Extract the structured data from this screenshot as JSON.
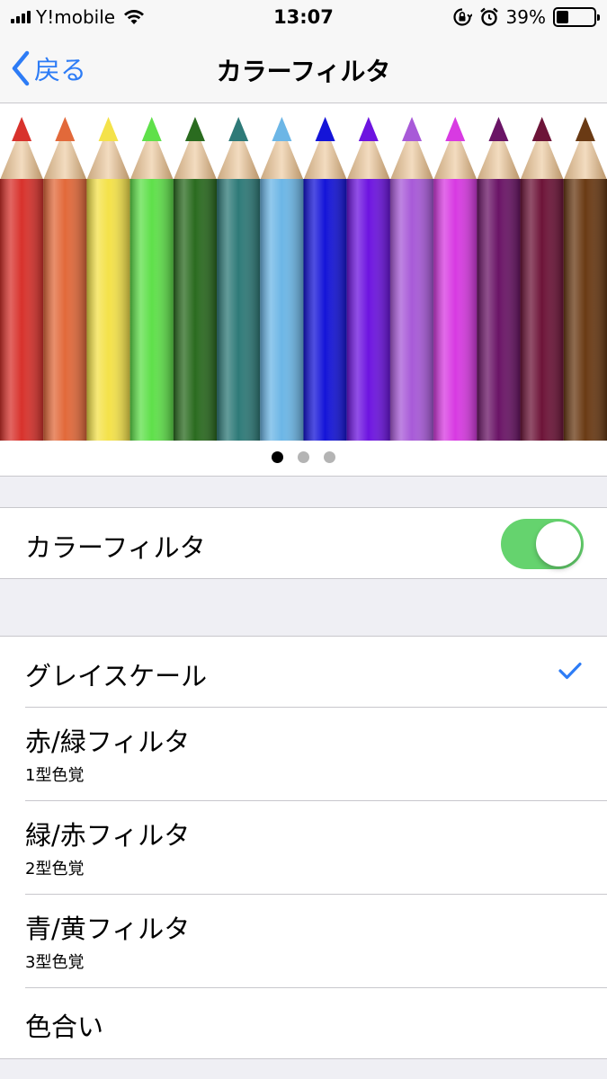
{
  "status_bar": {
    "carrier": "Y!mobile",
    "time": "13:07",
    "battery_percent": "39%",
    "battery_level": 0.39,
    "icons": [
      "signal-icon",
      "wifi-icon",
      "rotation-lock-icon",
      "alarm-icon",
      "battery-icon"
    ]
  },
  "nav": {
    "back_label": "戻る",
    "title": "カラーフィルタ"
  },
  "preview": {
    "pencil_colors": [
      "#d8322c",
      "#e2693a",
      "#f4e24a",
      "#5fe04a",
      "#2a6b1f",
      "#2e7a78",
      "#6cb6e6",
      "#1414d8",
      "#6d14e0",
      "#a85ad8",
      "#d83ae2",
      "#6a1466",
      "#6d1438",
      "#6a3a14"
    ],
    "pages": 3,
    "current_page": 1
  },
  "toggle": {
    "label": "カラーフィルタ",
    "on": true
  },
  "options": [
    {
      "title": "グレイスケール",
      "subtitle": "",
      "selected": true
    },
    {
      "title": "赤/緑フィルタ",
      "subtitle": "1型色覚",
      "selected": false
    },
    {
      "title": "緑/赤フィルタ",
      "subtitle": "2型色覚",
      "selected": false
    },
    {
      "title": "青/黄フィルタ",
      "subtitle": "3型色覚",
      "selected": false
    },
    {
      "title": "色合い",
      "subtitle": "",
      "selected": false
    }
  ],
  "colors": {
    "accent": "#2d7cf6",
    "switch_on": "#65d36e"
  }
}
